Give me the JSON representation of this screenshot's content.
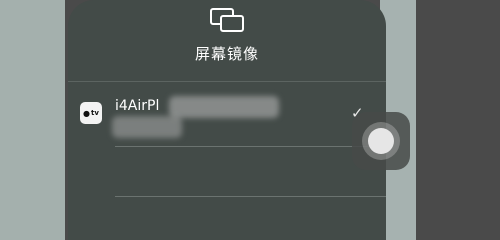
{
  "screen": {
    "title": "屏幕镜像",
    "title_icon": "screen-mirroring-icon"
  },
  "devices": [
    {
      "name": "i4AirPl",
      "badge_label": "tv",
      "badge_icon": "apple-tv-icon",
      "selected": true,
      "check_glyph": "✓"
    }
  ],
  "colors": {
    "panel": "#434b48",
    "text": "#ffffff",
    "side": "#a4b0ad"
  }
}
